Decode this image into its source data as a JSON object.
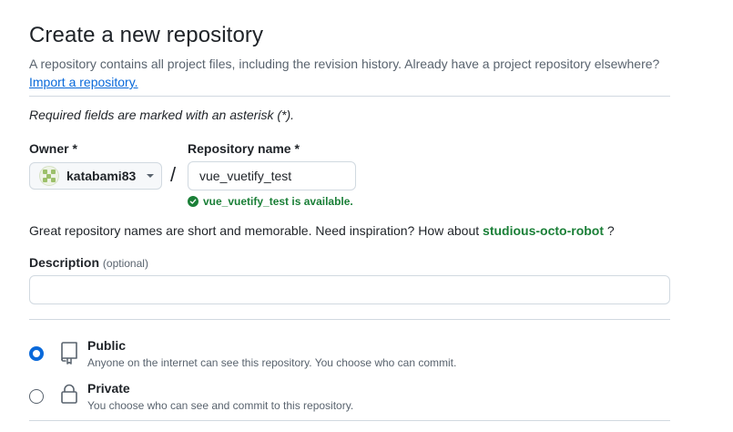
{
  "header": {
    "title": "Create a new repository",
    "subtitle": "A repository contains all project files, including the revision history. Already have a project repository elsewhere?",
    "import_link": "Import a repository."
  },
  "form": {
    "required_note": "Required fields are marked with an asterisk (*).",
    "owner": {
      "label": "Owner *",
      "value": "katabami83",
      "avatar_icon": "identicon"
    },
    "separator": "/",
    "repo_name": {
      "label": "Repository name *",
      "value": "vue_vuetify_test",
      "availability": "vue_vuetify_test is available.",
      "availability_icon": "check-circle-icon"
    },
    "inspiration": {
      "text": "Great repository names are short and memorable. Need inspiration? How about",
      "suggestion": "studious-octo-robot",
      "suffix": "?"
    },
    "description": {
      "label": "Description",
      "optional": "(optional)",
      "value": ""
    },
    "visibility": [
      {
        "title": "Public",
        "description": "Anyone on the internet can see this repository. You choose who can commit.",
        "icon": "repo-icon",
        "checked": true
      },
      {
        "title": "Private",
        "description": "You choose who can see and commit to this repository.",
        "icon": "lock-icon",
        "checked": false
      }
    ]
  },
  "colors": {
    "accent": "#0969da",
    "success": "#1a7f37",
    "muted": "#59636e",
    "border": "#d1d9e0"
  }
}
